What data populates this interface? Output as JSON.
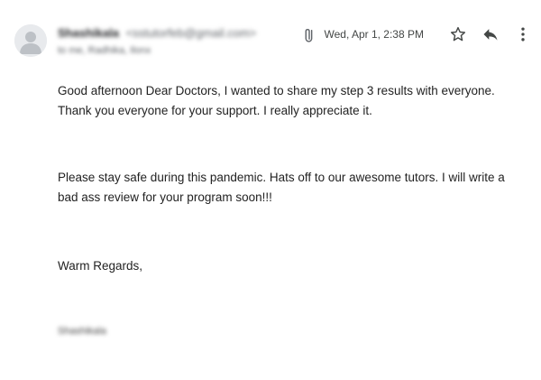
{
  "header": {
    "sender_name": "Shashikala",
    "sender_email": "<sstutorfeb@gmail.com>",
    "recipients": "to me, Radhika, Ilonx",
    "date": "Wed, Apr 1, 2:38 PM",
    "icons": {
      "attachment": "paperclip-icon",
      "star": "star-icon",
      "reply": "reply-icon",
      "more": "more-vertical-icon"
    }
  },
  "body": {
    "paragraph_1": "Good afternoon Dear Doctors, I wanted to share my step 3 results with everyone. Thank you everyone for your support. I really appreciate it.",
    "paragraph_2": "Please stay safe during this pandemic. Hats off to our awesome tutors. I will write a bad ass review for your program soon!!!",
    "closing": "Warm Regards,",
    "signature": "Shashikala"
  }
}
